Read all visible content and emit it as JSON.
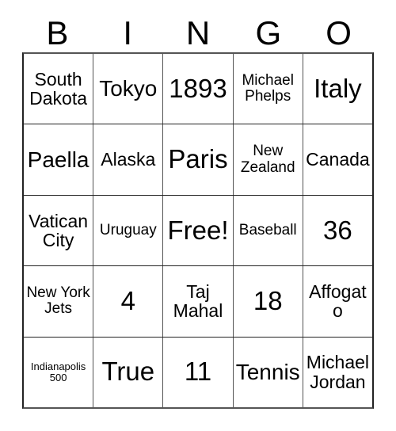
{
  "card": {
    "title": "Bingo Card",
    "header_letters": [
      "B",
      "I",
      "N",
      "G",
      "O"
    ],
    "grid": {
      "columns": 5,
      "rows": 5,
      "border_color": "#222222",
      "grid_line_color": "#555555",
      "background_color": "#ffffff",
      "text_color": "#000000",
      "free_space_label": "Free!",
      "free_space_position": {
        "row": 3,
        "column": 3
      },
      "rows_data": [
        [
          {
            "text": "South Dakota",
            "size": "lg"
          },
          {
            "text": "Tokyo",
            "size": "xl"
          },
          {
            "text": "1893",
            "size": "xxl"
          },
          {
            "text": "Michael Phelps",
            "size": "md"
          },
          {
            "text": "Italy",
            "size": "xxl"
          }
        ],
        [
          {
            "text": "Paella",
            "size": "xl"
          },
          {
            "text": "Alaska",
            "size": "lg"
          },
          {
            "text": "Paris",
            "size": "xxl"
          },
          {
            "text": "New Zealand",
            "size": "md"
          },
          {
            "text": "Canada",
            "size": "lg"
          }
        ],
        [
          {
            "text": "Vatican City",
            "size": "lg"
          },
          {
            "text": "Uruguay",
            "size": "md"
          },
          {
            "text": "Free!",
            "size": "xxl"
          },
          {
            "text": "Baseball",
            "size": "md"
          },
          {
            "text": "36",
            "size": "xxl"
          }
        ],
        [
          {
            "text": "New York Jets",
            "size": "md"
          },
          {
            "text": "4",
            "size": "xxl"
          },
          {
            "text": "Taj Mahal",
            "size": "lg"
          },
          {
            "text": "18",
            "size": "xxl"
          },
          {
            "text": "Affogato",
            "size": "lg"
          }
        ],
        [
          {
            "text": "Indianapolis 500",
            "size": "sm"
          },
          {
            "text": "True",
            "size": "xxl"
          },
          {
            "text": "11",
            "size": "xxl"
          },
          {
            "text": "Tennis",
            "size": "xl"
          },
          {
            "text": "Michael Jordan",
            "size": "lg"
          }
        ]
      ]
    }
  }
}
